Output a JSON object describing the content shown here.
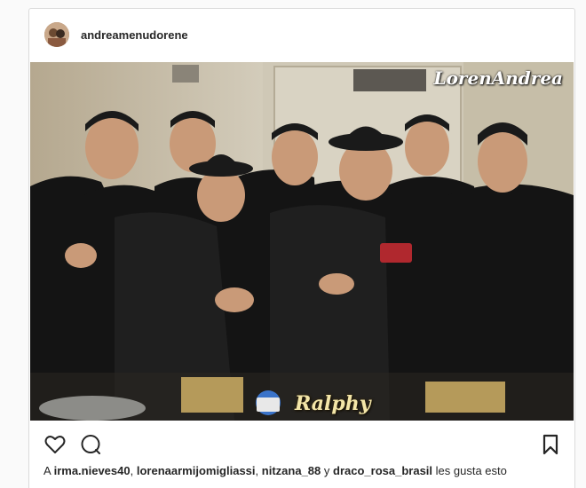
{
  "post": {
    "username": "andreamenudorene",
    "photo": {
      "watermark_top": "LorenAndrea",
      "watermark_bottom": "Ralphy"
    },
    "actions": {
      "like_icon": "heart-outline-icon",
      "comment_icon": "comment-bubble-icon",
      "save_icon": "bookmark-icon"
    },
    "likes": {
      "prefix": "A",
      "user1": "irma.nieves40",
      "sep1": ",",
      "user2": "lorenaarmijomigliassi",
      "sep2": ",",
      "user3": "nitzana_88",
      "conj": "y",
      "user4": "draco_rosa_brasil",
      "suffix": "les gusta esto"
    }
  },
  "colors": {
    "text": "#262626",
    "border": "#dbdbdb",
    "background": "#fafafa"
  }
}
